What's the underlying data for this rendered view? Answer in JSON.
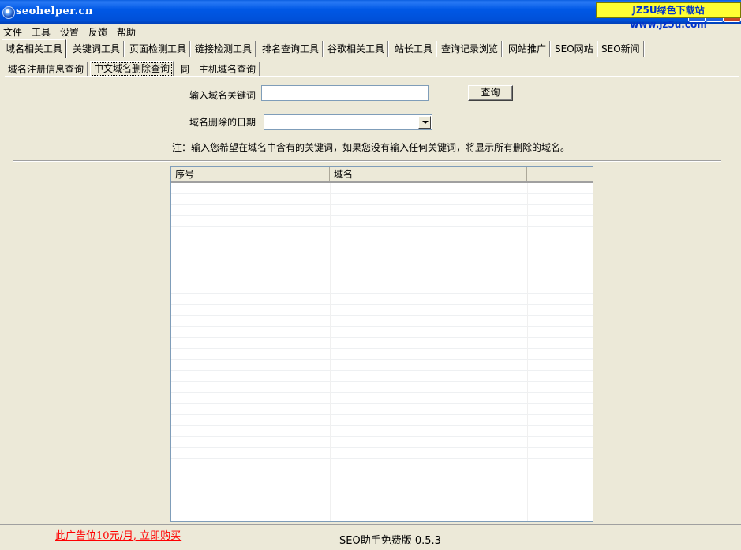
{
  "window": {
    "title": "seohelper.cn",
    "watermark": "JZ5U绿色下载站www.jz5u.com"
  },
  "menu": [
    "文件",
    "工具",
    "设置",
    "反馈",
    "帮助"
  ],
  "main_tabs": [
    "域名相关工具",
    "关键词工具",
    "页面检测工具",
    "链接检测工具",
    "排名查询工具",
    "谷歌相关工具",
    "站长工具",
    "查询记录浏览",
    "网站推广",
    "SEO网站",
    "SEO新闻"
  ],
  "active_main_tab": "域名相关工具",
  "sub_tabs": [
    "域名注册信息查询",
    "中文域名删除查询",
    "同一主机域名查询"
  ],
  "active_sub_tab": "中文域名删除查询",
  "form": {
    "keyword_label": "输入域名关键词",
    "keyword_value": "",
    "query_button": "查询",
    "date_label": "域名删除的日期",
    "date_value": "",
    "note": "注：输入您希望在域名中含有的关键词，如果您没有输入任何关键词，将显示所有删除的域名。"
  },
  "table": {
    "columns": [
      "序号",
      "域名",
      ""
    ],
    "rows": []
  },
  "status": {
    "ad_text": "此广告位10元/月, 立即购买",
    "version": "SEO助手免费版 0.5.3"
  }
}
